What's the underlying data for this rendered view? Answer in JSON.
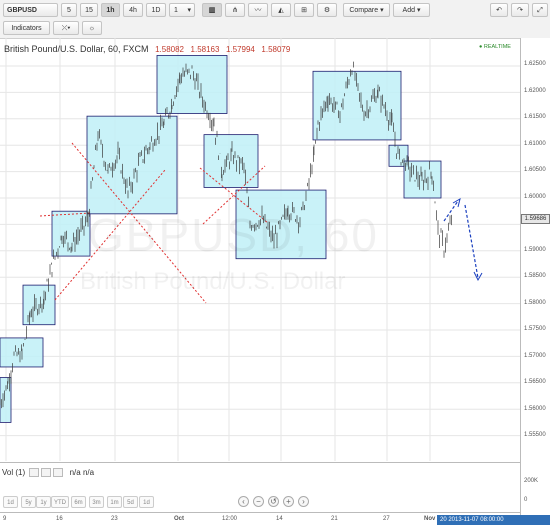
{
  "toolbar": {
    "symbol": "GBPUSD",
    "intervals": [
      "5",
      "15",
      "1h",
      "4h",
      "1D",
      "1"
    ],
    "active_interval": "1h",
    "compare_label": "Compare",
    "add_label": "Add",
    "indicators_label": "Indicators"
  },
  "legend": {
    "title": "British Pound/U.S. Dollar, 60, FXCM",
    "open": "1.58082",
    "high": "1.58163",
    "low": "1.57994",
    "close": "1.58079",
    "realtime": "REALTIME"
  },
  "watermark": {
    "symbol": "GBPUSD, 60",
    "name": "British Pound/U.S. Dollar"
  },
  "price_axis": {
    "labels": [
      "1.62500",
      "1.62000",
      "1.61500",
      "1.61000",
      "1.60500",
      "1.60000",
      "1.59500",
      "1.59000",
      "1.58500",
      "1.58000",
      "1.57500",
      "1.57000",
      "1.56500",
      "1.56000",
      "1.55500"
    ],
    "last_price": "1.59686"
  },
  "time_axis": {
    "labels": [
      "9",
      "16",
      "23",
      "Oct",
      "12:00",
      "14",
      "21",
      "27",
      "Nov"
    ],
    "cursor": "20  2013-11-07 08:00:00"
  },
  "volume": {
    "label": "Vol (1)",
    "value": "n/a n/a",
    "axis": [
      "200K",
      "0"
    ]
  },
  "ranges": [
    "1d",
    "5y",
    "1y",
    "YTD",
    "6m",
    "3m",
    "1m",
    "5d",
    "1d"
  ],
  "colors": {
    "box_fill": "#bff0f7",
    "box_border": "#1c1c6e",
    "guide_red": "#e03030",
    "arrow_blue": "#1a3fbf",
    "accent": "#2f6fb6"
  }
}
